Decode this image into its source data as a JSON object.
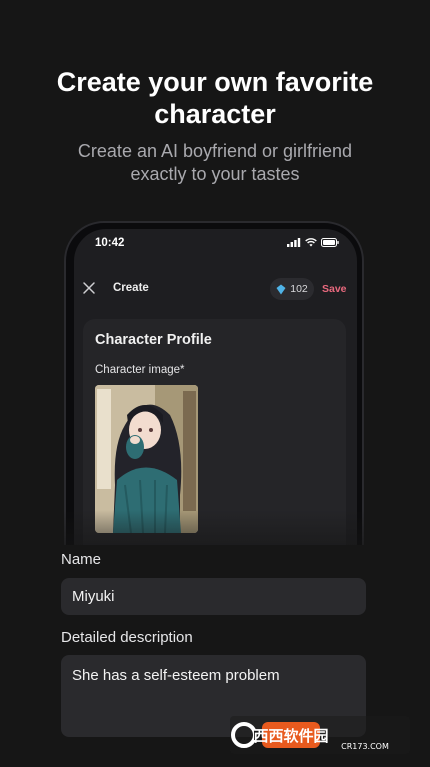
{
  "promo": {
    "headline_line1": "Create your own favorite",
    "headline_line2": "character",
    "subline_line1": "Create an AI boyfriend or girlfriend",
    "subline_line2": "exactly to your tastes"
  },
  "status_bar": {
    "time": "10:42"
  },
  "app_bar": {
    "title": "Create",
    "credits": "102",
    "save_label": "Save"
  },
  "profile": {
    "section_title": "Character Profile",
    "image_label": "Character image*"
  },
  "form": {
    "name_label": "Name",
    "name_value": "Miyuki",
    "description_label": "Detailed description",
    "description_value": "She has a self-esteem problem"
  },
  "watermark": {
    "brand": "西西软件园",
    "url": "CR173.COM"
  },
  "colors": {
    "accent_save": "#e9697e",
    "credit_gem": "#4fb3e8",
    "background": "#161616"
  }
}
